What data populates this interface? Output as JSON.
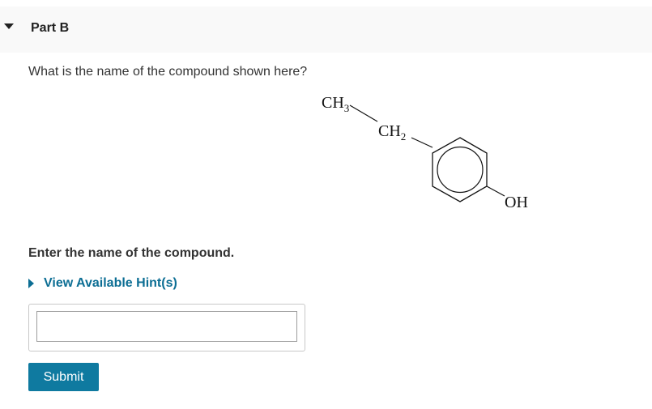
{
  "part": {
    "title": "Part B",
    "caret_icon": "chevron-down-icon"
  },
  "question": {
    "text": "What is the name of the compound shown here?"
  },
  "structure": {
    "labels": {
      "ch3": "CH",
      "ch3_sub": "3",
      "ch2": "CH",
      "ch2_sub": "2",
      "oh": "OH"
    }
  },
  "answer": {
    "prompt": "Enter the name of the compound.",
    "hint_label": "View Available Hint(s)",
    "hint_icon": "chevron-right-icon",
    "input_value": "",
    "submit_label": "Submit"
  },
  "colors": {
    "link": "#0c6e94",
    "submit_bg": "#0f7aa0",
    "header_bg": "#f9f9f9"
  }
}
